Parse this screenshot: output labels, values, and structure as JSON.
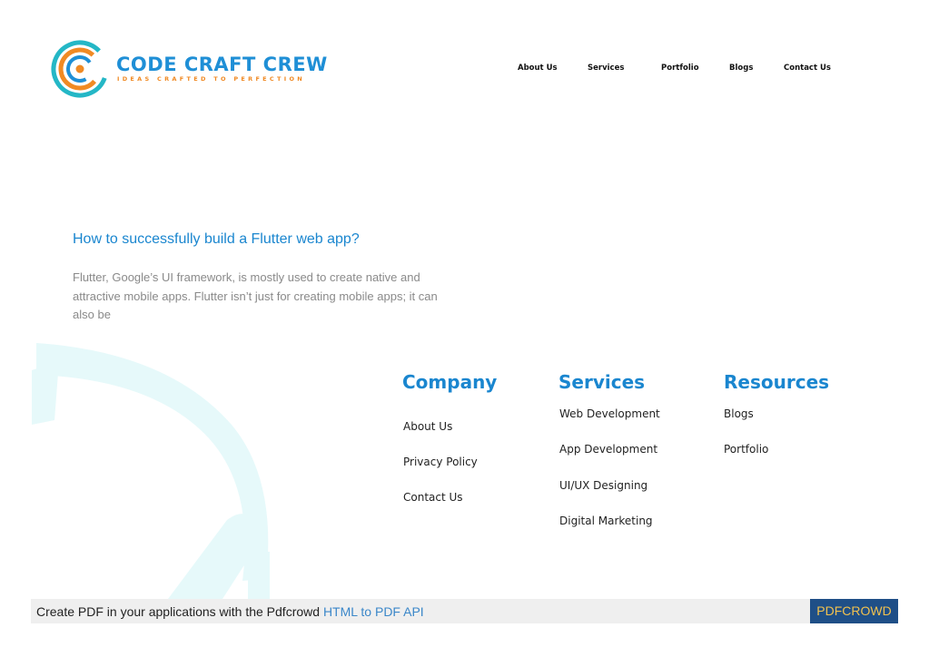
{
  "brand": {
    "name": "CODE CRAFT CREW",
    "tagline": "IDEAS CRAFTED TO PERFECTION",
    "colors": {
      "primary": "#1f8fd6",
      "accent": "#f08a24"
    }
  },
  "nav": {
    "items": [
      "About Us",
      "Services",
      "Portfolio",
      "Blogs",
      "Contact Us"
    ]
  },
  "post": {
    "title": "How to successfully build a Flutter web app?",
    "excerpt": "Flutter, Google’s UI framework, is mostly used to create native and attractive mobile apps. Flutter isn’t just for creating mobile apps; it can also be"
  },
  "footer": {
    "company": {
      "heading": "Company",
      "links": [
        "About Us",
        "Privacy Policy",
        "Contact Us"
      ]
    },
    "services": {
      "heading": "Services",
      "links": [
        "Web Development",
        "App Development",
        "UI/UX Designing",
        "Digital Marketing"
      ]
    },
    "resources": {
      "heading": "Resources",
      "links": [
        "Blogs",
        "Portfolio"
      ]
    }
  },
  "pdfcrowd": {
    "text": "Create PDF in your applications with the Pdfcrowd",
    "link": "HTML to PDF API",
    "badge": "PDFCROWD"
  }
}
